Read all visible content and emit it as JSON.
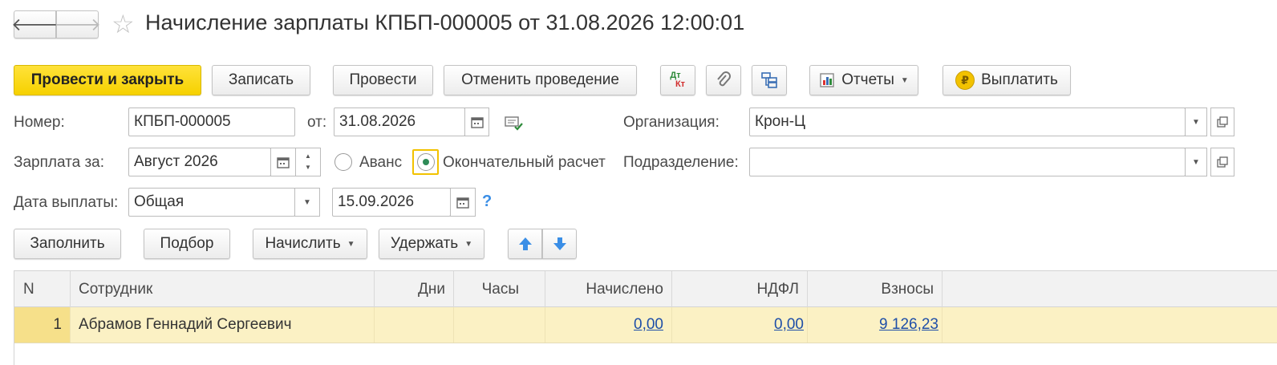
{
  "window": {
    "title": "Начисление зарплаты КПБП-000005 от 31.08.2026 12:00:01",
    "back_glyph": "🡐",
    "forward_glyph": "🡒",
    "star_glyph": "☆"
  },
  "toolbar": {
    "post_close": "Провести и закрыть",
    "save": "Записать",
    "post": "Провести",
    "unpost": "Отменить проведение",
    "dtkt_top": "Дт",
    "dtkt_bottom": "Кт",
    "reports": "Отчеты",
    "pay": "Выплатить",
    "pay_icon_glyph": "₽"
  },
  "form": {
    "number_label": "Номер:",
    "number_value": "КПБП-000005",
    "date_label": "от:",
    "date_value": "31.08.2026",
    "org_label": "Организация:",
    "org_value": "Крон-Ц",
    "salary_for_label": "Зарплата за:",
    "salary_for_value": "Август 2026",
    "advance_label": "Аванс",
    "final_label": "Окончательный расчет",
    "selected_option": "final",
    "dept_label": "Подразделение:",
    "dept_value": "",
    "pay_date_label": "Дата выплаты:",
    "pay_date_type": "Общая",
    "pay_date_value": "15.09.2026",
    "help_glyph": "?"
  },
  "table_toolbar": {
    "fill": "Заполнить",
    "select": "Подбор",
    "accrue": "Начислить",
    "withhold": "Удержать"
  },
  "table": {
    "columns": [
      "N",
      "Сотрудник",
      "Дни",
      "Часы",
      "Начислено",
      "НДФЛ",
      "Взносы"
    ],
    "rows": [
      {
        "n": "1",
        "employee": "Абрамов Геннадий Сергеевич",
        "days": "",
        "hours": "",
        "accrued": "0,00",
        "ndfl": "0,00",
        "contributions": "9 126,23"
      }
    ]
  },
  "colors": {
    "primary_button": "#f6d100",
    "selected_row": "#fbf1c4",
    "link": "#1f4fa8",
    "arrow_blue": "#3a8ee6"
  }
}
